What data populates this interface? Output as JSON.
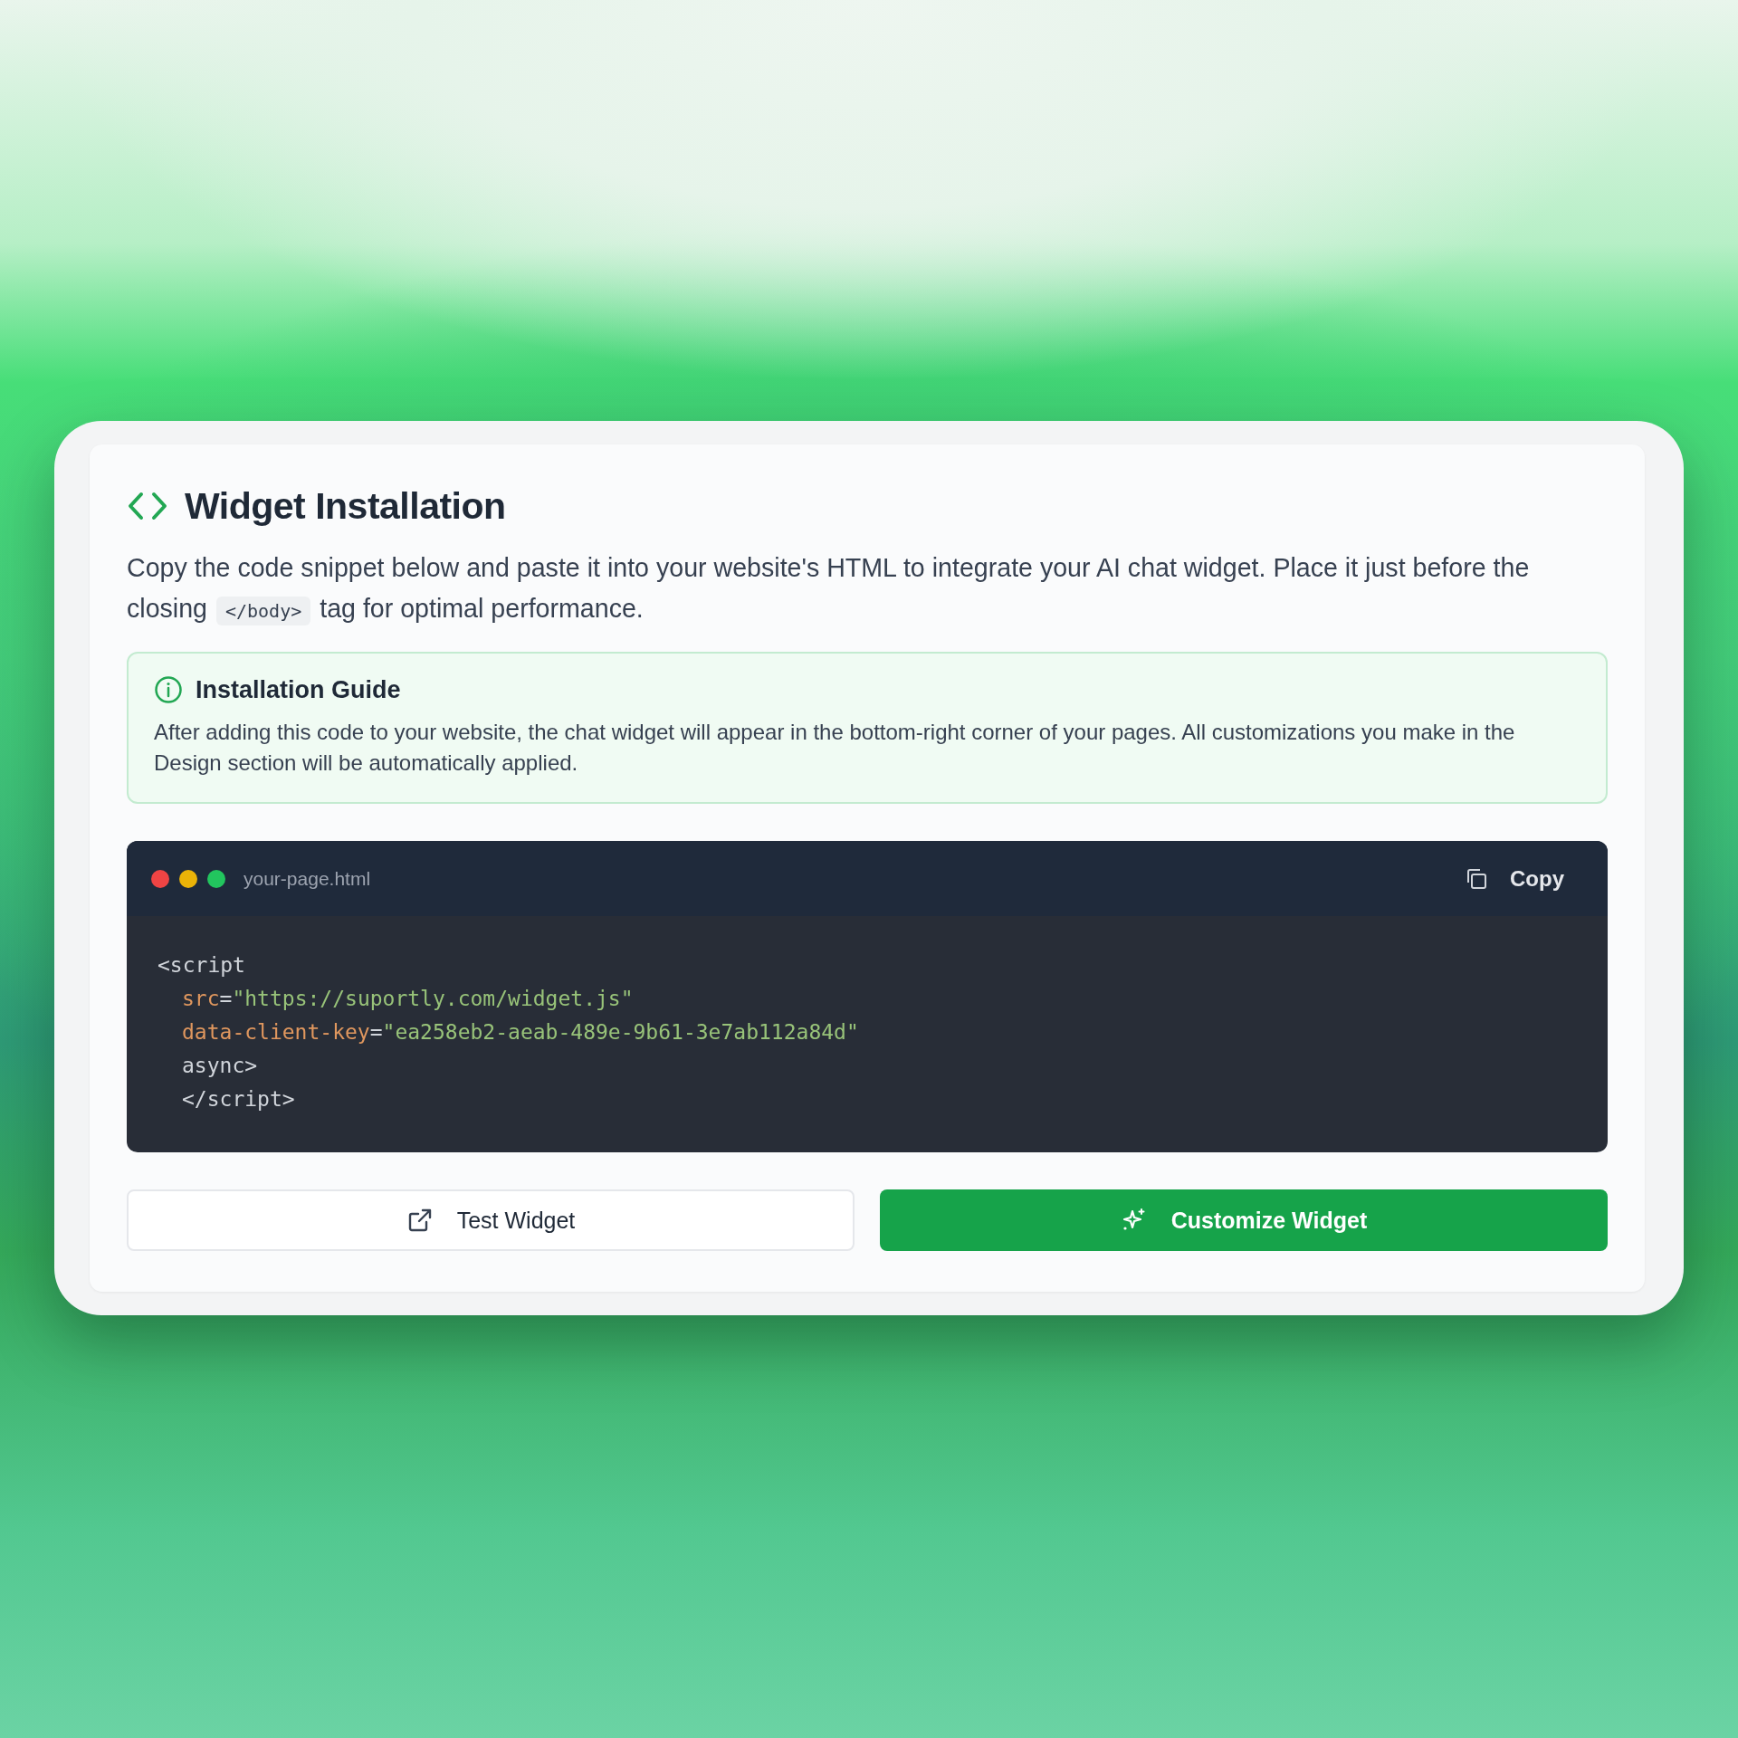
{
  "title": "Widget Installation",
  "description": [
    {
      "kind": "text",
      "text": "Copy the code snippet below and paste it into your website's HTML to integrate your AI chat widget. Place it just before the closing "
    },
    {
      "kind": "code",
      "text": "</body>"
    },
    {
      "kind": "text",
      "text": " tag for optimal performance."
    }
  ],
  "guide": {
    "title": "Installation Guide",
    "body": "After adding this code to your website, the chat widget will appear in the bottom-right corner of your pages. All customizations you make in the Design section will be automatically applied."
  },
  "code_block": {
    "filename": "your-page.html",
    "copy_label": "Copy",
    "lines": [
      {
        "tokens": [
          {
            "kind": "tag",
            "text": "<script"
          }
        ],
        "children": [
          {
            "tokens": [
              {
                "kind": "attr",
                "text": "src"
              },
              {
                "kind": "tag",
                "text": "="
              },
              {
                "kind": "string",
                "text": "\"https://suportly.com/widget.js\""
              }
            ]
          },
          {
            "tokens": [
              {
                "kind": "attr",
                "text": "data-client-key"
              },
              {
                "kind": "tag",
                "text": "="
              },
              {
                "kind": "string",
                "text": "\"ea258eb2-aeab-489e-9b61-3e7ab112a84d\""
              }
            ]
          },
          {
            "tokens": [
              {
                "kind": "tag",
                "text": "async>"
              }
            ]
          },
          {
            "tokens": [
              {
                "kind": "tag",
                "text": "</script>"
              }
            ]
          }
        ]
      }
    ]
  },
  "buttons": [
    {
      "kind": "secondary",
      "label": "Test Widget"
    },
    {
      "kind": "primary",
      "label": "Customize Widget"
    }
  ]
}
